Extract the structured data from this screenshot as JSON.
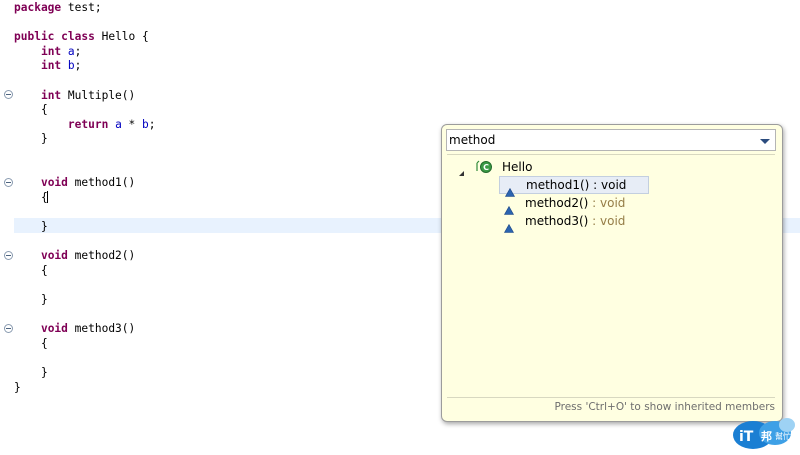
{
  "code_lines": [
    {
      "parts": [
        {
          "t": "package",
          "c": "kw"
        },
        {
          "t": " test;"
        }
      ]
    },
    {
      "parts": []
    },
    {
      "parts": [
        {
          "t": "public",
          "c": "kw"
        },
        {
          "t": " "
        },
        {
          "t": "class",
          "c": "kw"
        },
        {
          "t": " Hello {"
        }
      ]
    },
    {
      "parts": [
        {
          "t": "    "
        },
        {
          "t": "int",
          "c": "kw"
        },
        {
          "t": " "
        },
        {
          "t": "a",
          "c": "fld"
        },
        {
          "t": ";"
        }
      ]
    },
    {
      "parts": [
        {
          "t": "    "
        },
        {
          "t": "int",
          "c": "kw"
        },
        {
          "t": " "
        },
        {
          "t": "b",
          "c": "fld"
        },
        {
          "t": ";"
        }
      ]
    },
    {
      "parts": []
    },
    {
      "parts": [
        {
          "t": "    "
        },
        {
          "t": "int",
          "c": "kw"
        },
        {
          "t": " Multiple()"
        }
      ]
    },
    {
      "parts": [
        {
          "t": "    {"
        }
      ]
    },
    {
      "parts": [
        {
          "t": "        "
        },
        {
          "t": "return",
          "c": "kw"
        },
        {
          "t": " "
        },
        {
          "t": "a",
          "c": "fld"
        },
        {
          "t": " * "
        },
        {
          "t": "b",
          "c": "fld"
        },
        {
          "t": ";"
        }
      ]
    },
    {
      "parts": [
        {
          "t": "    }"
        }
      ]
    },
    {
      "parts": []
    },
    {
      "parts": []
    },
    {
      "parts": [
        {
          "t": "    "
        },
        {
          "t": "void",
          "c": "kw"
        },
        {
          "t": " method1()"
        }
      ]
    },
    {
      "parts": [
        {
          "t": "    {"
        }
      ]
    },
    {
      "parts": []
    },
    {
      "parts": [
        {
          "t": "    }"
        }
      ]
    },
    {
      "parts": []
    },
    {
      "parts": [
        {
          "t": "    "
        },
        {
          "t": "void",
          "c": "kw"
        },
        {
          "t": " method2()"
        }
      ]
    },
    {
      "parts": [
        {
          "t": "    {"
        }
      ]
    },
    {
      "parts": []
    },
    {
      "parts": [
        {
          "t": "    }"
        }
      ]
    },
    {
      "parts": []
    },
    {
      "parts": [
        {
          "t": "    "
        },
        {
          "t": "void",
          "c": "kw"
        },
        {
          "t": " method3()"
        }
      ]
    },
    {
      "parts": [
        {
          "t": "    {"
        }
      ]
    },
    {
      "parts": []
    },
    {
      "parts": [
        {
          "t": "    }"
        }
      ]
    },
    {
      "parts": [
        {
          "t": "}"
        }
      ]
    }
  ],
  "quick_outline": {
    "filter_value": "method",
    "class_name": "Hello",
    "members": [
      {
        "name": "method1()",
        "ret": " : void",
        "selected": true
      },
      {
        "name": "method2()",
        "ret": " : void",
        "selected": false
      },
      {
        "name": "method3()",
        "ret": " : void",
        "selected": false
      }
    ],
    "status_hint": "Press 'Ctrl+O' to show inherited members"
  },
  "watermark": {
    "text": "iT邦幫忙"
  },
  "colors": {
    "keyword": "#7f0055",
    "field": "#0000c0",
    "popup_bg": "#ffffe1",
    "current_line": "#e8f2fe",
    "return_type": "#957d47"
  }
}
